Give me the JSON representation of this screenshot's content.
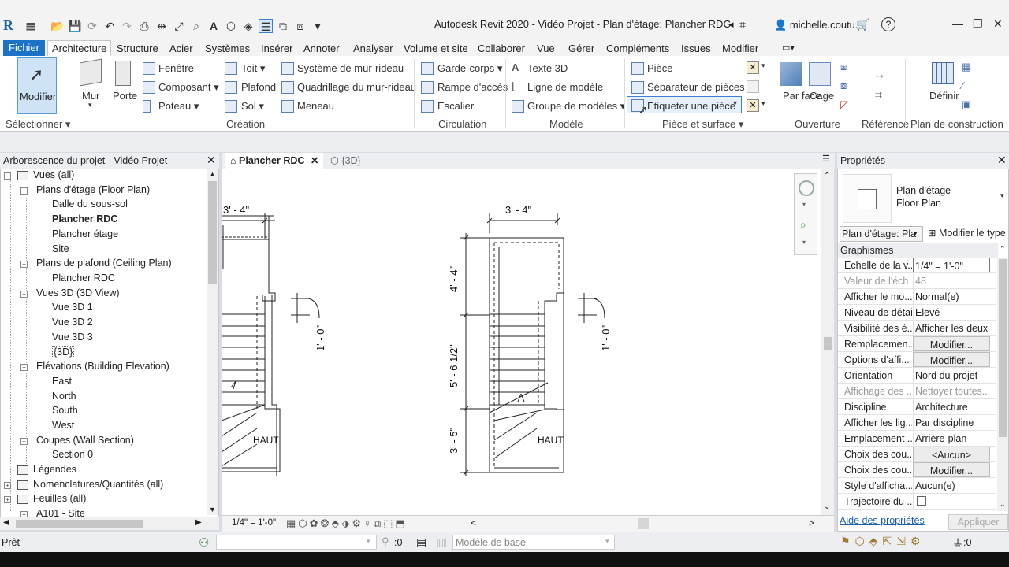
{
  "title": {
    "app_title": "Autodesk Revit 2020 - Vidéo Projet - Plan d'étage: Plancher RDC",
    "user": "michelle.coutu...",
    "logo": "R"
  },
  "menu_tabs": [
    "Fichier",
    "Architecture",
    "Structure",
    "Acier",
    "Systèmes",
    "Insérer",
    "Annoter",
    "Analyser",
    "Volume et site",
    "Collaborer",
    "Vue",
    "Gérer",
    "Compléments",
    "Issues",
    "Modifier"
  ],
  "ribbon": {
    "modify": "Modifier",
    "select": "Sélectionner",
    "wall": "Mur",
    "door": "Porte",
    "window": "Fenêtre",
    "component": "Composant",
    "column": "Poteau",
    "roof": "Toit",
    "ceiling": "Plafond",
    "floor": "Sol",
    "curtain_system": "Système de mur-rideau",
    "curtain_grid": "Quadrillage du mur-rideau",
    "mullion": "Meneau",
    "railing": "Garde-corps",
    "ramp": "Rampe d'accès",
    "stair": "Escalier",
    "model_text": "Texte 3D",
    "model_line": "Ligne de modèle",
    "model_group": "Groupe de modèles",
    "room": "Pièce",
    "room_separator": "Séparateur de pièces",
    "tag_room": "Etiqueter  une pièce",
    "by_face": "Par face",
    "shaft": "Cage",
    "set": "Définir",
    "groups": {
      "creation": "Création",
      "circulation": "Circulation",
      "model": "Modèle",
      "room_area": "Pièce et surface",
      "opening": "Ouverture",
      "datum": "Référence",
      "work_plane": "Plan de construction"
    }
  },
  "browser": {
    "title": "Arborescence du projet - Vidéo Projet",
    "items": [
      {
        "label": "Vues (all)",
        "bold": false
      },
      {
        "label": "Plans d'étage (Floor Plan)",
        "bold": false
      },
      {
        "label": "Dalle du sous-sol",
        "bold": false
      },
      {
        "label": "Plancher RDC",
        "bold": true
      },
      {
        "label": "Plancher étage",
        "bold": false
      },
      {
        "label": "Site",
        "bold": false
      },
      {
        "label": "Plans de plafond (Ceiling Plan)",
        "bold": false
      },
      {
        "label": "Plancher RDC",
        "bold": false
      },
      {
        "label": "Vues 3D (3D View)",
        "bold": false
      },
      {
        "label": "Vue 3D 1",
        "bold": false
      },
      {
        "label": "Vue 3D 2",
        "bold": false
      },
      {
        "label": "Vue 3D 3",
        "bold": false
      },
      {
        "label": "{3D}",
        "bold": false
      },
      {
        "label": "Elévations (Building Elevation)",
        "bold": false
      },
      {
        "label": "East",
        "bold": false
      },
      {
        "label": "North",
        "bold": false
      },
      {
        "label": "South",
        "bold": false
      },
      {
        "label": "West",
        "bold": false
      },
      {
        "label": "Coupes (Wall Section)",
        "bold": false
      },
      {
        "label": "Section 0",
        "bold": false
      },
      {
        "label": "Légendes",
        "bold": false
      },
      {
        "label": "Nomenclatures/Quantités (all)",
        "bold": false
      },
      {
        "label": "Feuilles (all)",
        "bold": false
      },
      {
        "label": "A101 - Site",
        "bold": false
      }
    ]
  },
  "view": {
    "tab_active": "Plancher RDC",
    "tab_other": "{3D}",
    "scale": "1/4\" = 1'-0\"",
    "dims": {
      "left_top": "3' - 4\"",
      "left_side": "1' - 0\"",
      "right_top": "3' - 4\"",
      "right_v1": "4' - 4\"",
      "right_v2": "5' - 6 1/2\"",
      "right_v3": "3' - 5\"",
      "right_side": "1' - 0\"",
      "up_label_left": "HAUT",
      "up_label_right": "HAUT"
    }
  },
  "properties": {
    "title": "Propriétés",
    "type_line1": "Plan d'étage",
    "type_line2": "Floor Plan",
    "selector": "Plan d'étage: Pla",
    "edit_type": "Modifier le type",
    "section": "Graphismes",
    "rows": [
      {
        "k": "Echelle de la v...",
        "v": "1/4\" = 1'-0\"",
        "style": "input"
      },
      {
        "k": "Valeur de l'éch...",
        "v": "48",
        "style": "grey"
      },
      {
        "k": "Afficher le mo...",
        "v": "Normal(e)",
        "style": ""
      },
      {
        "k": "Niveau de détail",
        "v": "Elevé",
        "style": ""
      },
      {
        "k": "Visibilité des é...",
        "v": "Afficher les deux",
        "style": ""
      },
      {
        "k": "Remplacemen...",
        "v": "Modifier...",
        "style": "btn"
      },
      {
        "k": "Options d'affi...",
        "v": "Modifier...",
        "style": "btn"
      },
      {
        "k": "Orientation",
        "v": "Nord du projet",
        "style": ""
      },
      {
        "k": "Affichage des ...",
        "v": "Nettoyer toutes...",
        "style": "grey"
      },
      {
        "k": "Discipline",
        "v": "Architecture",
        "style": ""
      },
      {
        "k": "Afficher les lig...",
        "v": "Par discipline",
        "style": ""
      },
      {
        "k": "Emplacement ...",
        "v": "Arrière-plan",
        "style": ""
      },
      {
        "k": "Choix des cou...",
        "v": "<Aucun>",
        "style": "btn"
      },
      {
        "k": "Choix des cou...",
        "v": "Modifier...",
        "style": "btn"
      },
      {
        "k": "Style d'afficha...",
        "v": "Aucun(e)",
        "style": ""
      },
      {
        "k": "Trajectoire du ...",
        "v": "",
        "style": "check"
      }
    ],
    "help": "Aide des propriétés",
    "apply": "Appliquer"
  },
  "status": {
    "ready": "Prêt",
    "count": ":0",
    "model": "Modèle de base",
    "filter_count": ":0"
  },
  "colors": {
    "file_tab": "#1c72c4",
    "accent": "#3c7fd0"
  }
}
